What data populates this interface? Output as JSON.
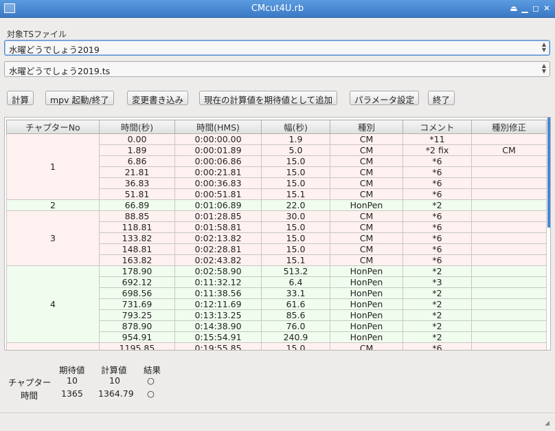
{
  "window": {
    "title": "CMcut4U.rb"
  },
  "ts_label": "対象TSファイル",
  "combo1": {
    "value": "水曜どうでしょう2019"
  },
  "combo2": {
    "value": "水曜どうでしょう2019.ts"
  },
  "buttons": {
    "calc": "計算",
    "mpv": "mpv 起動/終了",
    "write": "変更書き込み",
    "add_expect": "現在の計算値を期待値として追加",
    "params": "パラメータ設定",
    "quit": "終了"
  },
  "table": {
    "headers": [
      "チャプターNo",
      "時間(秒)",
      "時間(HMS)",
      "幅(秒)",
      "種別",
      "コメント",
      "種別修正"
    ],
    "groups": [
      {
        "chapter": "1",
        "color": "pink",
        "rows": [
          [
            "0.00",
            "0:00:00.00",
            "1.9",
            "CM",
            "*11",
            ""
          ],
          [
            "1.89",
            "0:00:01.89",
            "5.0",
            "CM",
            "*2 fix",
            "CM"
          ],
          [
            "6.86",
            "0:00:06.86",
            "15.0",
            "CM",
            "*6",
            ""
          ],
          [
            "21.81",
            "0:00:21.81",
            "15.0",
            "CM",
            "*6",
            ""
          ],
          [
            "36.83",
            "0:00:36.83",
            "15.0",
            "CM",
            "*6",
            ""
          ],
          [
            "51.81",
            "0:00:51.81",
            "15.1",
            "CM",
            "*6",
            ""
          ]
        ]
      },
      {
        "chapter": "2",
        "color": "green",
        "rows": [
          [
            "66.89",
            "0:01:06.89",
            "22.0",
            "HonPen",
            "*2",
            ""
          ]
        ]
      },
      {
        "chapter": "3",
        "color": "pink",
        "rows": [
          [
            "88.85",
            "0:01:28.85",
            "30.0",
            "CM",
            "*6",
            ""
          ],
          [
            "118.81",
            "0:01:58.81",
            "15.0",
            "CM",
            "*6",
            ""
          ],
          [
            "133.82",
            "0:02:13.82",
            "15.0",
            "CM",
            "*6",
            ""
          ],
          [
            "148.81",
            "0:02:28.81",
            "15.0",
            "CM",
            "*6",
            ""
          ],
          [
            "163.82",
            "0:02:43.82",
            "15.1",
            "CM",
            "*6",
            ""
          ]
        ]
      },
      {
        "chapter": "4",
        "color": "green",
        "rows": [
          [
            "178.90",
            "0:02:58.90",
            "513.2",
            "HonPen",
            "*2",
            ""
          ],
          [
            "692.12",
            "0:11:32.12",
            "6.4",
            "HonPen",
            "*3",
            ""
          ],
          [
            "698.56",
            "0:11:38.56",
            "33.1",
            "HonPen",
            "*2",
            ""
          ],
          [
            "731.69",
            "0:12:11.69",
            "61.6",
            "HonPen",
            "*2",
            ""
          ],
          [
            "793.25",
            "0:13:13.25",
            "85.6",
            "HonPen",
            "*2",
            ""
          ],
          [
            "878.90",
            "0:14:38.90",
            "76.0",
            "HonPen",
            "*2",
            ""
          ],
          [
            "954.91",
            "0:15:54.91",
            "240.9",
            "HonPen",
            "*2",
            ""
          ]
        ]
      },
      {
        "chapter": "",
        "color": "pink",
        "rows": [
          [
            "1195.85",
            "0:19:55.85",
            "15.0",
            "CM",
            "*6",
            ""
          ]
        ]
      }
    ]
  },
  "summary": {
    "headers": [
      "期待値",
      "計算値",
      "結果"
    ],
    "rows": [
      {
        "label": "チャプター",
        "expected": "10",
        "calculated": "10",
        "result": "○"
      },
      {
        "label": "時間",
        "expected": "1365",
        "calculated": "1364.79",
        "result": "○"
      }
    ]
  }
}
